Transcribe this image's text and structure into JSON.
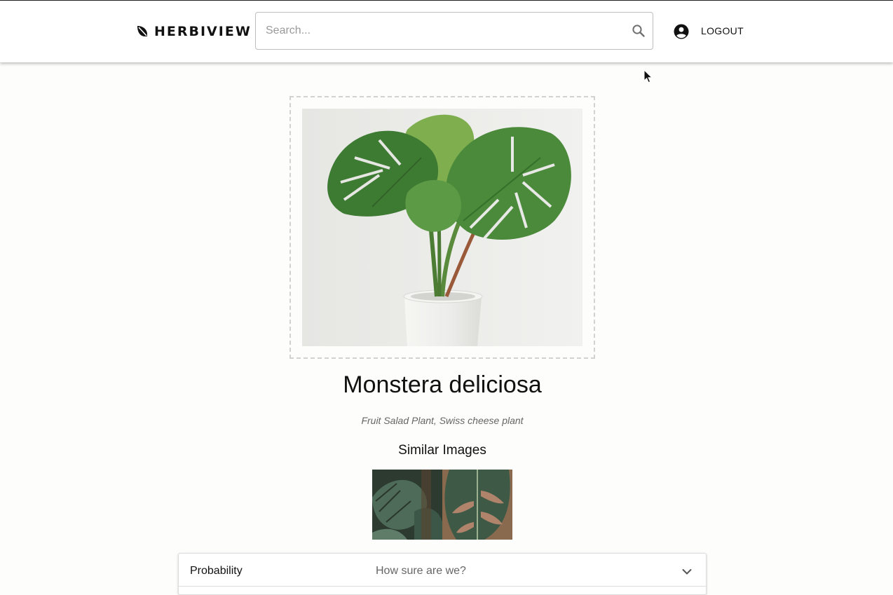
{
  "app": {
    "brand": "HERBIVIEW",
    "logo_icon": "leaf-icon"
  },
  "header": {
    "search_placeholder": "Search...",
    "search_value": "",
    "search_icon": "search-icon",
    "account_icon": "account-circle-icon",
    "logout_label": "LOGOUT"
  },
  "plant": {
    "scientific_name": "Monstera deliciosa",
    "common_names": "Fruit Salad Plant, Swiss cheese plant",
    "main_image": "monstera-plant-photo"
  },
  "similar": {
    "heading": "Similar Images",
    "images": [
      "monstera-leaves-photo-1",
      "monstera-leaf-photo-2"
    ]
  },
  "accordion": {
    "title": "Probability",
    "subtitle": "How sure are we?",
    "icon": "chevron-down-icon"
  },
  "colors": {
    "background": "#fdfdfb",
    "leaf_green": "#3f7a34",
    "text": "#111111",
    "muted": "#666666"
  }
}
